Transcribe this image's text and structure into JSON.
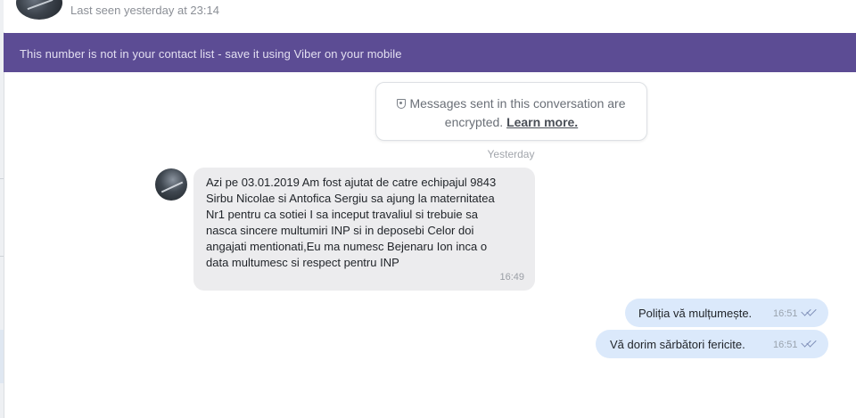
{
  "header": {
    "last_seen": "Last seen yesterday at 23:14"
  },
  "banner": {
    "text": "This number is not in your contact list - save it using Viber on your mobile"
  },
  "encryption_notice": {
    "line1": "Messages sent in this conversation are",
    "line2_prefix": "encrypted. ",
    "learn_more": "Learn more."
  },
  "date_separator": "Yesterday",
  "messages": {
    "incoming": {
      "text": "Azi pe 03.01.2019 Am fost ajutat de catre echipajul 9843\nSirbu Nicolae si Antofica Sergiu sa ajung la maternitatea\nNr1 pentru ca sotiei I sa inceput travaliul si trebuie sa\nnasca sincere multumiri INP si in deposebi Celor doi\nangajati mentionati,Eu ma numesc Bejenaru Ion inca o\ndata multumesc si respect pentru INP",
      "time": "16:49"
    },
    "outgoing": [
      {
        "text": "Poliția vă mulțumește.",
        "time": "16:51",
        "status_icon": "double-check-icon"
      },
      {
        "text": "Vă dorim sărbători fericite.",
        "time": "16:51",
        "status_icon": "double-check-icon"
      }
    ]
  },
  "colors": {
    "banner_bg": "#5c4c94",
    "outgoing_bubble": "#dbe9fb",
    "incoming_bubble": "#ececee"
  }
}
